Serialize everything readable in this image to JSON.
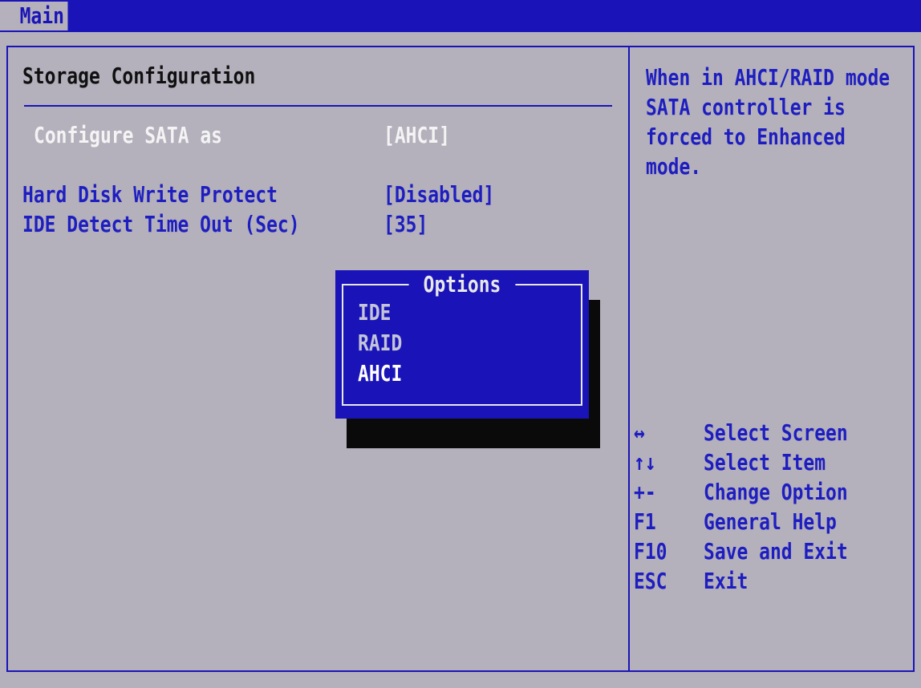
{
  "tabs": [
    {
      "label": "Main",
      "active": true
    }
  ],
  "main": {
    "section_title": "Storage Configuration",
    "rows": [
      {
        "label": "Configure SATA as",
        "value": "[AHCI]",
        "selected": true
      },
      {
        "label": "Hard Disk Write Protect",
        "value": "[Disabled]",
        "selected": false
      },
      {
        "label": "IDE Detect Time Out (Sec)",
        "value": "[35]",
        "selected": false
      }
    ]
  },
  "help": {
    "lines": [
      "When in AHCI/RAID mode",
      "SATA controller is",
      "forced to Enhanced",
      "mode."
    ]
  },
  "keys": [
    {
      "key": "↔",
      "description": "Select Screen"
    },
    {
      "key": "↑↓",
      "description": "Select Item"
    },
    {
      "key": "+-",
      "description": "Change Option"
    },
    {
      "key": "F1",
      "description": "General Help"
    },
    {
      "key": "F10",
      "description": "Save and Exit"
    },
    {
      "key": "ESC",
      "description": "Exit"
    }
  ],
  "popup": {
    "title": "Options",
    "options": [
      "IDE",
      "RAID",
      "AHCI"
    ],
    "selected": "AHCI"
  },
  "colors": {
    "background": "#b4b0bc",
    "accent_blue": "#1a14b8",
    "highlight_text": "#f4f4f4"
  }
}
